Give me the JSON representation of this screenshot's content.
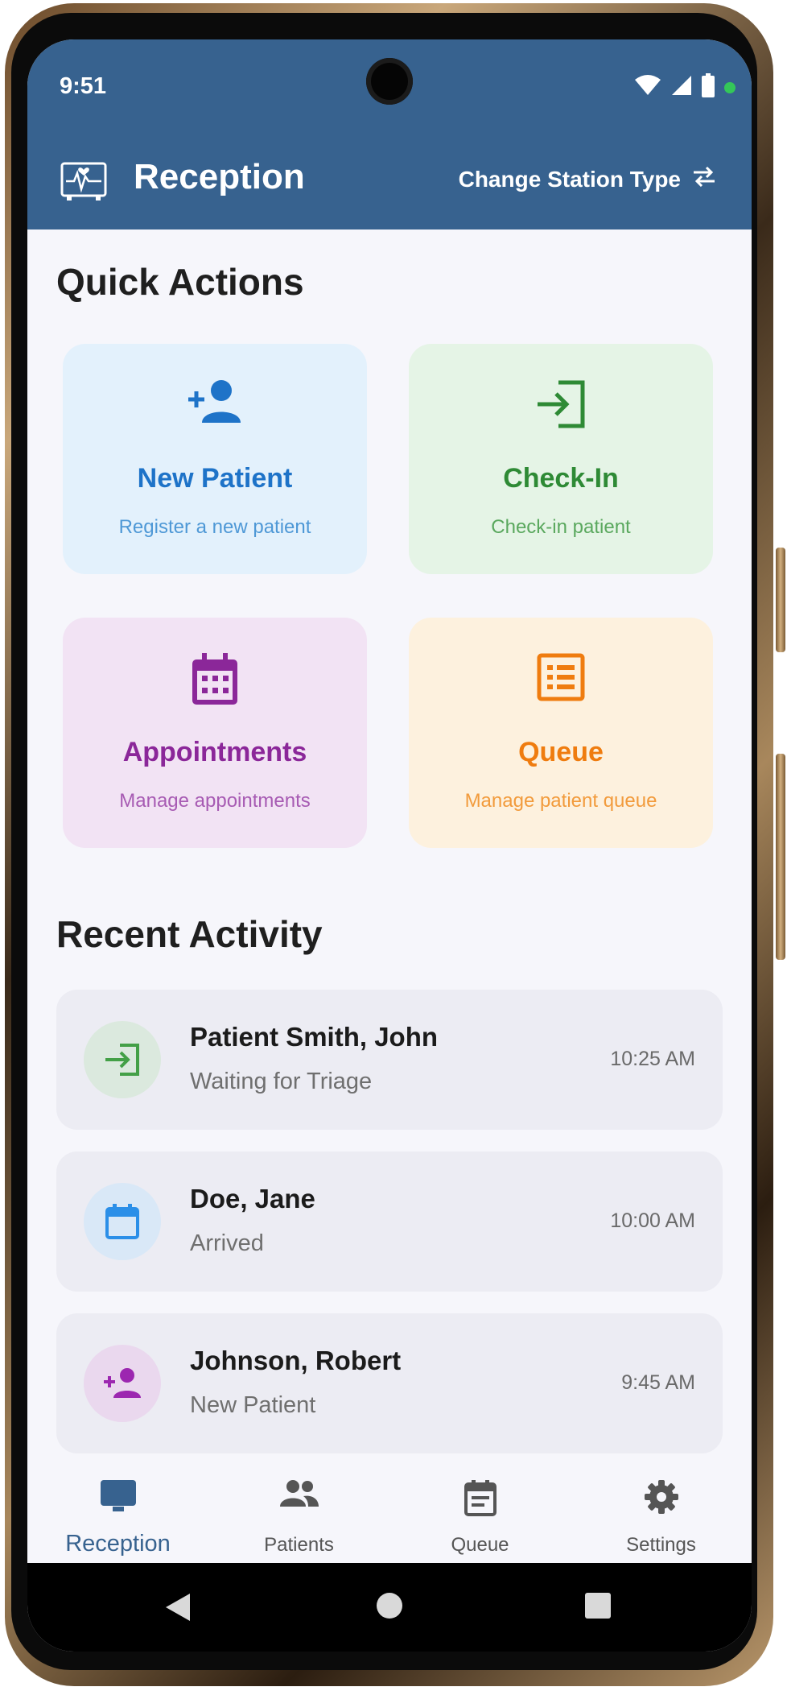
{
  "status_bar": {
    "time": "9:51"
  },
  "header": {
    "title": "Reception",
    "station_button": "Change Station Type"
  },
  "quick_actions": {
    "title": "Quick Actions",
    "cards": [
      {
        "title": "New Patient",
        "subtitle": "Register a new patient",
        "icon": "person-add-icon",
        "bg": "#e3f1fc",
        "color": "#1e73c8",
        "sub_color": "#4e98d6"
      },
      {
        "title": "Check-In",
        "subtitle": "Check-in patient",
        "icon": "login-icon",
        "bg": "#e5f4e6",
        "color": "#2e8a35",
        "sub_color": "#5aa85e"
      },
      {
        "title": "Appointments",
        "subtitle": "Manage appointments",
        "icon": "calendar-icon",
        "bg": "#f2e3f4",
        "color": "#8b2799",
        "sub_color": "#a75bb3"
      },
      {
        "title": "Queue",
        "subtitle": "Manage patient queue",
        "icon": "list-icon",
        "bg": "#fdf1de",
        "color": "#ef7c0f",
        "sub_color": "#f29b3c"
      }
    ]
  },
  "recent_activity": {
    "title": "Recent Activity",
    "items": [
      {
        "name": "Patient Smith, John",
        "status": "Waiting for Triage",
        "time": "10:25 AM",
        "icon": "login-icon",
        "icon_bg": "#dbe9de",
        "icon_color": "#43a047"
      },
      {
        "name": "Doe, Jane",
        "status": "Arrived",
        "time": "10:00 AM",
        "icon": "calendar-icon",
        "icon_bg": "#d9e8f7",
        "icon_color": "#2b8fe8"
      },
      {
        "name": "Johnson, Robert",
        "status": "New Patient",
        "time": "9:45 AM",
        "icon": "person-add-icon",
        "icon_bg": "#ead8ee",
        "icon_color": "#9c27b0"
      }
    ]
  },
  "bottom_nav": {
    "items": [
      {
        "label": "Reception",
        "icon": "monitor-icon",
        "active": true
      },
      {
        "label": "Patients",
        "icon": "people-icon",
        "active": false
      },
      {
        "label": "Queue",
        "icon": "clipboard-icon",
        "active": false
      },
      {
        "label": "Settings",
        "icon": "gear-icon",
        "active": false
      }
    ]
  },
  "colors": {
    "primary": "#37628f",
    "background": "#f6f6fb"
  }
}
